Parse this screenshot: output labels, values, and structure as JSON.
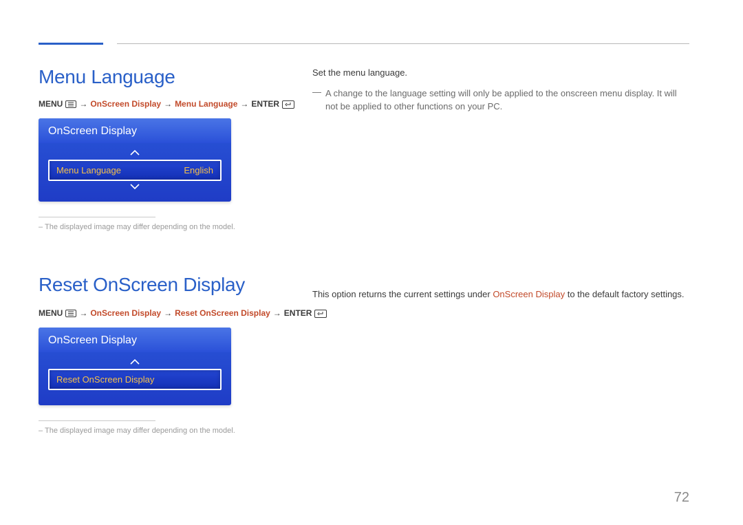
{
  "page_number": "72",
  "section1": {
    "heading": "Menu Language",
    "breadcrumb": {
      "menu": "MENU",
      "path1": "OnScreen Display",
      "path2": "Menu Language",
      "enter": "ENTER"
    },
    "osd": {
      "title": "OnScreen Display",
      "row_label": "Menu Language",
      "row_value": "English"
    },
    "footnote": "The displayed image may differ depending on the model.",
    "right": {
      "para": "Set the menu language.",
      "note": "A change to the language setting will only be applied to the onscreen menu display. It will not be applied to other functions on your PC."
    }
  },
  "section2": {
    "heading": "Reset OnScreen Display",
    "breadcrumb": {
      "menu": "MENU",
      "path1": "OnScreen Display",
      "path2": "Reset OnScreen Display",
      "enter": "ENTER"
    },
    "osd": {
      "title": "OnScreen Display",
      "row_label": "Reset OnScreen Display"
    },
    "footnote": "The displayed image may differ depending on the model.",
    "right": {
      "para_pre": "This option returns the current settings under ",
      "para_colored": "OnScreen Display",
      "para_post": " to the default factory settings."
    }
  }
}
